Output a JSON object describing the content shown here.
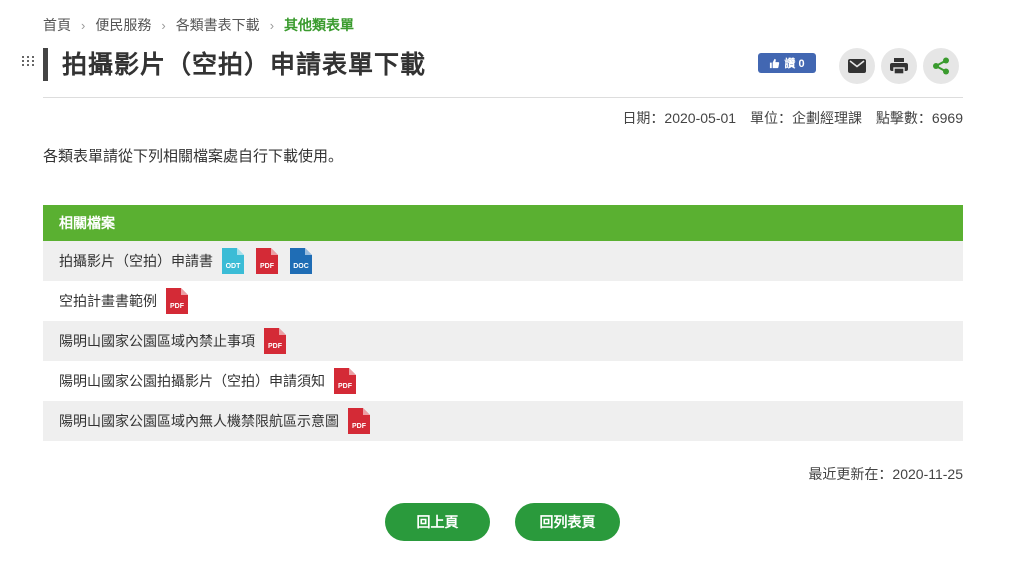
{
  "breadcrumb": {
    "items": [
      "首頁",
      "便民服務",
      "各類書表下載"
    ],
    "current": "其他類表單"
  },
  "page_title": "拍攝影片（空拍）申請表單下載",
  "toolbar": {
    "fb_like": "讚 0",
    "mail_icon": "mail-icon",
    "print_icon": "print-icon",
    "share_icon": "share-icon"
  },
  "meta": {
    "date": "日期：2020-05-01",
    "unit": "單位：企劃經理課",
    "hits": "點擊數：6969"
  },
  "intro": "各類表單請從下列相關檔案處自行下載使用。",
  "files": {
    "heading": "相關檔案",
    "rows": [
      {
        "name": "拍攝影片（空拍）申請書",
        "formats": [
          "ODT",
          "PDF",
          "DOC"
        ]
      },
      {
        "name": "空拍計畫書範例",
        "formats": [
          "PDF"
        ]
      },
      {
        "name": "陽明山國家公園區域內禁止事項",
        "formats": [
          "PDF"
        ]
      },
      {
        "name": "陽明山國家公園拍攝影片（空拍）申請須知",
        "formats": [
          "PDF"
        ]
      },
      {
        "name": "陽明山國家公園區域內無人機禁限航區示意圖",
        "formats": [
          "PDF"
        ]
      }
    ]
  },
  "updated": "最近更新在：2020-11-25",
  "buttons": {
    "back": "回上頁",
    "list": "回列表頁"
  },
  "colors": {
    "accent_green": "#5ab031",
    "breadcrumb_current": "#3a9b2e",
    "button_green": "#2a9a3c",
    "odt": "#3bbcd6",
    "pdf": "#d42a36",
    "doc": "#1f6db5"
  }
}
